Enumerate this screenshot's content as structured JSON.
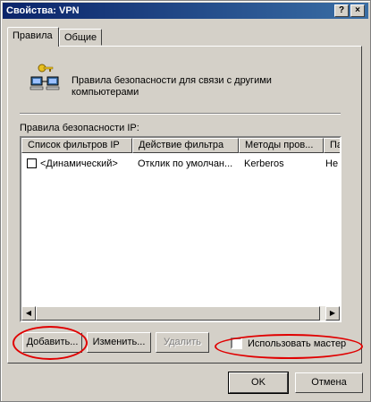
{
  "window": {
    "title": "Свойства: VPN",
    "help_label": "?",
    "close_label": "×"
  },
  "tabs": [
    {
      "label": "Правила",
      "active": true
    },
    {
      "label": "Общие",
      "active": false
    }
  ],
  "description": "Правила безопасности для связи с другими компьютерами",
  "rules_label": "Правила безопасности IP:",
  "table": {
    "columns": [
      "Список фильтров IP",
      "Действие фильтра",
      "Методы пров...",
      "Па"
    ],
    "rows": [
      {
        "checked": false,
        "filter_list": "<Динамический>",
        "action": "Отклик по умолчан...",
        "methods": "Kerberos",
        "extra": "Не"
      }
    ]
  },
  "buttons": {
    "add": "Добавить...",
    "edit": "Изменить...",
    "remove": "Удалить",
    "ok": "OK",
    "cancel": "Отмена"
  },
  "use_wizard": {
    "label": "Использовать мастер",
    "checked": false
  },
  "colors": {
    "highlight": "#e00000",
    "titlebar": "#0a246a"
  },
  "icons": {
    "policy": "network-security-icon"
  }
}
